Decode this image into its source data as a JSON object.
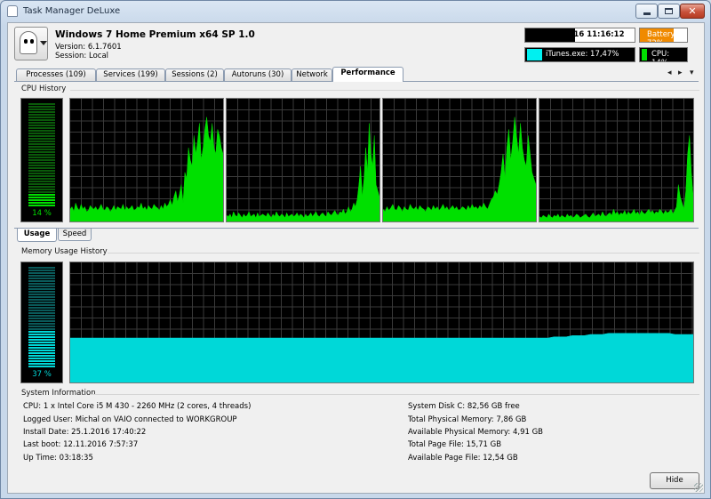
{
  "window": {
    "title": "Task Manager DeLuxe"
  },
  "header": {
    "system_name": "Windows 7 Home Premium x64 SP 1.0",
    "version": "Version: 6.1.7601",
    "session": "Session: Local",
    "datetime": "12.11.2016 11:16:12",
    "battery": {
      "label": "Battery: 72%",
      "level_percent": 72,
      "color": "#f08a00"
    },
    "top_process": {
      "label": "iTunes.exe: 17,47%",
      "color": "#00f0f0"
    },
    "cpu": {
      "label": "CPU: 14%",
      "color": "#00e000"
    }
  },
  "tabs": [
    {
      "label": "Processes (109)"
    },
    {
      "label": "Services (199)"
    },
    {
      "label": "Sessions (2)"
    },
    {
      "label": "Autoruns (30)"
    },
    {
      "label": "Network"
    },
    {
      "label": "Performance",
      "active": true
    }
  ],
  "tab_nav": {
    "prev": "◂",
    "next": "▸",
    "menu": "▾"
  },
  "cpu_history": {
    "label": "CPU History",
    "usage_percent": 14,
    "usage_label": "14 %",
    "color": "#00e000",
    "cores": [
      {
        "samples": [
          10,
          12,
          8,
          15,
          11,
          9,
          14,
          10,
          12,
          8,
          9,
          13,
          11,
          10,
          12,
          9,
          11,
          14,
          10,
          9,
          12,
          11,
          8,
          10,
          13,
          9,
          12,
          11,
          10,
          14,
          9,
          12,
          10,
          11,
          13,
          9,
          10,
          12,
          11,
          15,
          10,
          12,
          9,
          13,
          11,
          10,
          14,
          12,
          11,
          9,
          13,
          10,
          15,
          12,
          14,
          18,
          13,
          20,
          25,
          16,
          22,
          30,
          15,
          40,
          35,
          60,
          50,
          45,
          70,
          55,
          65,
          80,
          50,
          60,
          75,
          85,
          70,
          65,
          80,
          60,
          55,
          75,
          70,
          60,
          55
        ]
      },
      {
        "samples": [
          5,
          4,
          6,
          3,
          8,
          5,
          4,
          7,
          5,
          3,
          6,
          4,
          5,
          8,
          4,
          5,
          6,
          3,
          7,
          4,
          5,
          6,
          5,
          4,
          7,
          5,
          3,
          6,
          4,
          8,
          5,
          4,
          6,
          5,
          3,
          7,
          4,
          5,
          6,
          4,
          5,
          7,
          4,
          6,
          5,
          3,
          6,
          4,
          5,
          7,
          4,
          6,
          8,
          5,
          4,
          6,
          7,
          5,
          4,
          8,
          6,
          5,
          7,
          9,
          6,
          5,
          8,
          7,
          10,
          6,
          8,
          12,
          8,
          10,
          15,
          12,
          18,
          30,
          45,
          20,
          35,
          60,
          40,
          80,
          55,
          45,
          70,
          30,
          25,
          20
        ]
      },
      {
        "samples": [
          10,
          8,
          12,
          9,
          11,
          14,
          10,
          9,
          13,
          11,
          8,
          12,
          10,
          9,
          14,
          11,
          10,
          12,
          9,
          13,
          11,
          10,
          8,
          12,
          11,
          9,
          13,
          10,
          12,
          9,
          11,
          14,
          10,
          12,
          9,
          11,
          13,
          10,
          12,
          9,
          10,
          12,
          11,
          9,
          13,
          10,
          14,
          11,
          12,
          10,
          13,
          11,
          15,
          12,
          10,
          14,
          18,
          20,
          25,
          22,
          30,
          40,
          55,
          35,
          60,
          75,
          50,
          65,
          85,
          70,
          55,
          80,
          60,
          50,
          45,
          70,
          55,
          40,
          35,
          30
        ]
      },
      {
        "samples": [
          4,
          3,
          5,
          4,
          3,
          6,
          4,
          3,
          5,
          4,
          6,
          3,
          5,
          4,
          3,
          6,
          4,
          5,
          3,
          4,
          6,
          5,
          3,
          4,
          5,
          6,
          4,
          3,
          5,
          7,
          4,
          5,
          6,
          4,
          8,
          5,
          4,
          6,
          7,
          5,
          10,
          6,
          8,
          5,
          7,
          6,
          9,
          5,
          8,
          6,
          7,
          10,
          6,
          8,
          5,
          9,
          7,
          6,
          8,
          10,
          7,
          9,
          6,
          8,
          7,
          10,
          8,
          6,
          9,
          7,
          8,
          10,
          6,
          9,
          12,
          30,
          20,
          15,
          10,
          25,
          55,
          70,
          40,
          20
        ]
      }
    ]
  },
  "subtabs": [
    {
      "label": "Usage",
      "active": true
    },
    {
      "label": "Speed"
    }
  ],
  "memory_history": {
    "label": "Memory Usage History",
    "usage_percent": 37,
    "usage_label": "37 %",
    "color": "#00d8d8",
    "samples": [
      37,
      37,
      37,
      37,
      37,
      37,
      37,
      37,
      37,
      37,
      37,
      37,
      37,
      37,
      37,
      37,
      37,
      37,
      37,
      37,
      37,
      37,
      37,
      37,
      37,
      37,
      37,
      37,
      37,
      37,
      37,
      37,
      37,
      37,
      37,
      37,
      37,
      37,
      37,
      37,
      37,
      37,
      37,
      37,
      37,
      37,
      37,
      37,
      37,
      37,
      37,
      37,
      37,
      37,
      37,
      37,
      37,
      37,
      37,
      37,
      37,
      37,
      37,
      37,
      37,
      37,
      37,
      37,
      37,
      37,
      37,
      37,
      37,
      37,
      37,
      37,
      37,
      37,
      37,
      37,
      38,
      38,
      38,
      39,
      39,
      39,
      40,
      40,
      40,
      41,
      41,
      41,
      41,
      41,
      41,
      41,
      41,
      41,
      41,
      41,
      40,
      40,
      40,
      40
    ]
  },
  "system_information": {
    "label": "System Information",
    "left": [
      "CPU: 1 x Intel Core i5 M 430 - 2260 MHz (2 cores, 4 threads)",
      "Logged User: Michal on VAIO connected to WORKGROUP",
      "Install Date: 25.1.2016 17:40:22",
      "Last boot: 12.11.2016 7:57:37",
      "Up Time: 03:18:35"
    ],
    "right": [
      "System Disk C: 82,56 GB free",
      "Total Physical Memory: 7,86 GB",
      "Available Physical Memory: 4,91 GB",
      "Total Page File: 15,71 GB",
      "Available Page File: 12,54 GB"
    ]
  },
  "footer": {
    "hide_label": "Hide"
  }
}
